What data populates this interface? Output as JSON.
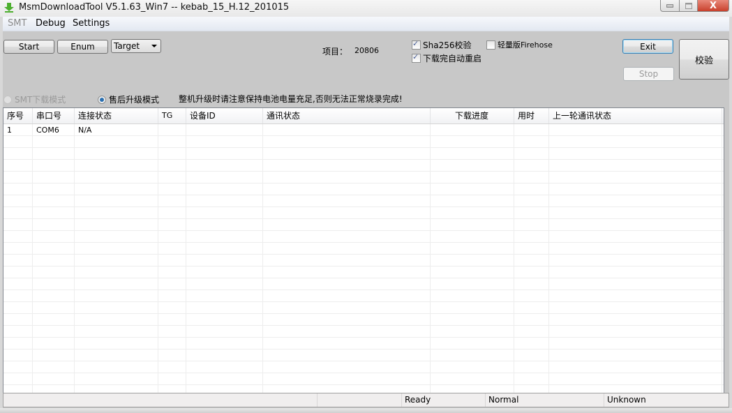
{
  "window": {
    "title": "MsmDownloadTool V5.1.63_Win7 -- kebab_15_H.12_201015",
    "close_glyph": "X"
  },
  "menu": {
    "items": [
      {
        "label": "SMT",
        "disabled": true
      },
      {
        "label": "Debug"
      },
      {
        "label": "Settings"
      }
    ]
  },
  "toolbar": {
    "start_label": "Start",
    "enum_label": "Enum",
    "target_select": "Target",
    "project_label": "项目：",
    "project_value": "20806",
    "sha256_label": "Sha256校验",
    "sha256_checked": true,
    "auto_reboot_label": "下载完自动重启",
    "auto_reboot_checked": true,
    "lite_firehose_label": "轻量版Firehose",
    "lite_firehose_checked": false,
    "exit_label": "Exit",
    "stop_label": "Stop",
    "verify_label": "校验"
  },
  "modes": {
    "smt_label": "SMT下载模式",
    "aftersales_label": "售后升级模式",
    "selected": "aftersales",
    "warning": "整机升级时请注意保持电池电量充足,否则无法正常烧录完成!"
  },
  "grid": {
    "columns": [
      "序号",
      "串口号",
      "连接状态",
      "TG",
      "设备ID",
      "通讯状态",
      "下载进度",
      "用时",
      "上一轮通讯状态"
    ],
    "rows": [
      [
        "1",
        "COM6",
        "N/A",
        "",
        "",
        "",
        "",
        "",
        ""
      ]
    ]
  },
  "statusbar": {
    "cells": [
      "",
      "",
      "Ready",
      "Normal",
      "Unknown"
    ]
  },
  "colors": {
    "panel_bg": "#c8c8c8",
    "close_red": "#c8402c",
    "radio_blue": "#2a6fb0",
    "check_blue": "#4a5f97"
  }
}
